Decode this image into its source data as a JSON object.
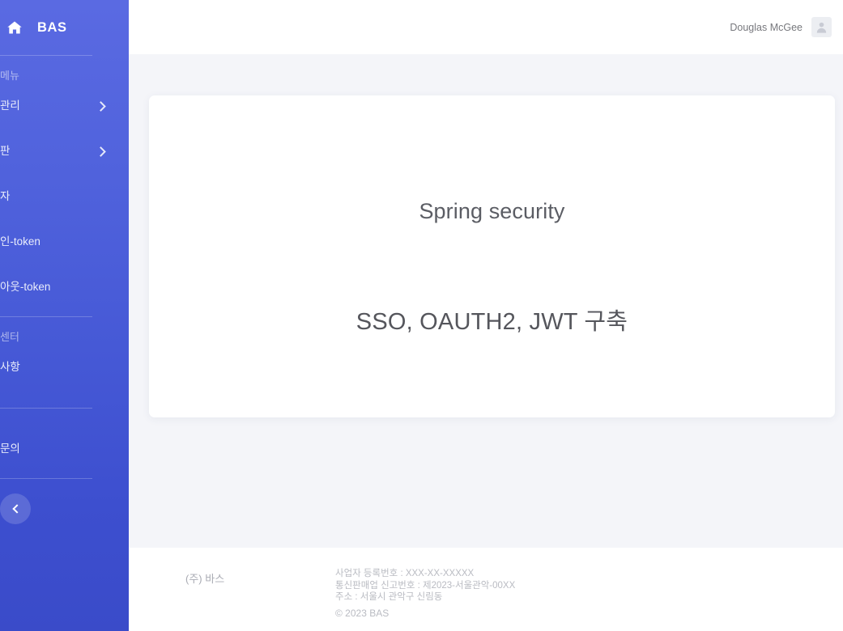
{
  "brand": {
    "home_icon": "home-icon",
    "name": "BAS"
  },
  "sidebar": {
    "menu_section_label": "메뉴",
    "items": [
      {
        "label": "관리",
        "has_chevron": true
      },
      {
        "label": "판",
        "has_chevron": true
      },
      {
        "label": "자",
        "has_chevron": false
      },
      {
        "label": "인-token",
        "has_chevron": false
      },
      {
        "label": "아웃-token",
        "has_chevron": false
      }
    ],
    "support_section_label": "센터",
    "support_items": [
      {
        "label": "사항",
        "has_chevron": false
      }
    ],
    "contact_items": [
      {
        "label": "문의",
        "has_chevron": false
      }
    ],
    "collapse_icon": "chevron-left-icon"
  },
  "header": {
    "user_name": "Douglas McGee",
    "avatar_icon": "user-avatar-icon"
  },
  "main": {
    "card": {
      "title": "Spring security",
      "subtitle": "SSO, OAUTH2, JWT 구축"
    }
  },
  "footer": {
    "company": "(주) 바스",
    "business_number": "사업자 등록번호 : XXX-XX-XXXXX",
    "telecom_number": "통신판매업 신고번호 : 제2023-서울관악-00XX",
    "address": "주소 : 서울시 관악구 신림동",
    "copyright": "© 2023 BAS"
  },
  "colors": {
    "sidebar_top": "#5a6ae2",
    "sidebar_bottom": "#3a4bc9",
    "main_bg": "#f4f5f9",
    "card_bg": "#ffffff",
    "text_muted": "#b9bbc2"
  }
}
